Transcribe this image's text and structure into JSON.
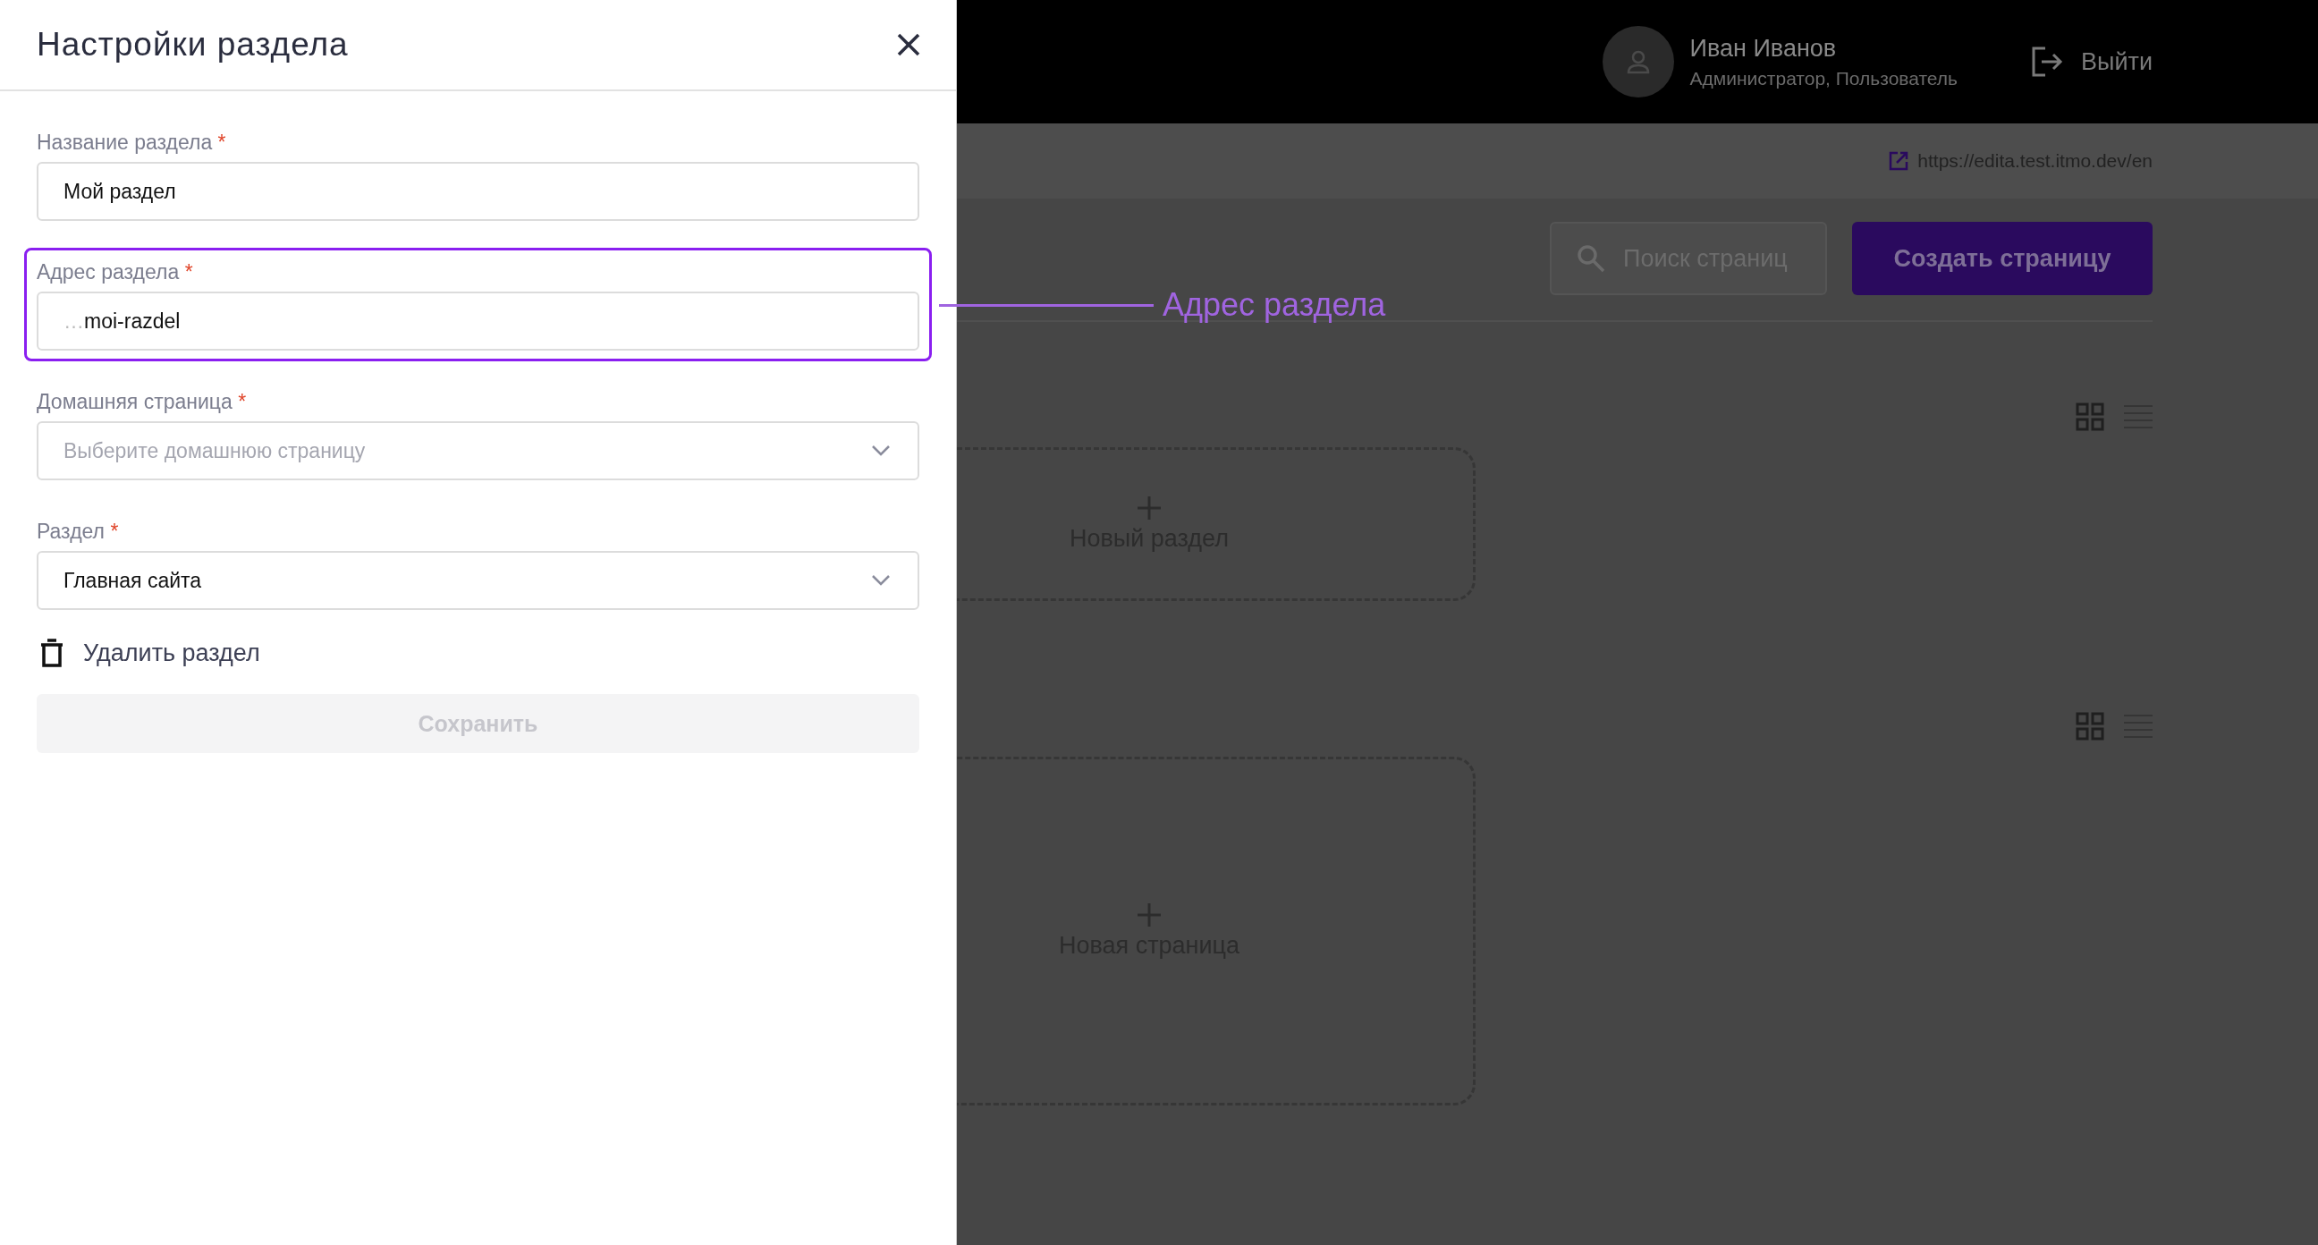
{
  "page": {
    "user": {
      "name": "Иван Иванов",
      "role": "Администратор, Пользователь"
    },
    "logout": "Выйти",
    "site_url": "https://edita.test.itmo.dev/en",
    "search": {
      "placeholder": "Поиск страниц"
    },
    "create_button": "Создать страницу",
    "sections": [
      {
        "view_modes": [
          {
            "kind": "grid",
            "selected": true
          },
          {
            "kind": "list",
            "selected": false
          }
        ],
        "card": {
          "kind": "short",
          "label": "Новый раздел"
        }
      },
      {
        "view_modes": [
          {
            "kind": "grid",
            "selected": true
          },
          {
            "kind": "list",
            "selected": false
          }
        ],
        "card": {
          "kind": "tall",
          "label": "Новая страница"
        }
      }
    ]
  },
  "drawer": {
    "title": "Настройки раздела",
    "fields": [
      {
        "kind": "text",
        "label": "Название раздела",
        "required_mark": "*",
        "value": "Мой раздел",
        "highlighted": false
      },
      {
        "kind": "text",
        "label": "Адрес раздела",
        "required_mark": "*",
        "prefix": "…",
        "value": "moi-razdel",
        "highlighted": true
      },
      {
        "kind": "select",
        "label": "Домашняя страница",
        "required_mark": "*",
        "placeholder": "Выберите домашнюю страницу",
        "highlighted": false
      },
      {
        "kind": "select",
        "label": "Раздел",
        "required_mark": "*",
        "value": "Главная сайта",
        "highlighted": false
      }
    ],
    "delete_label": "Удалить раздел",
    "save_button": {
      "label": "Сохранить",
      "disabled": true
    }
  },
  "annotation": {
    "label": "Адрес раздела"
  }
}
